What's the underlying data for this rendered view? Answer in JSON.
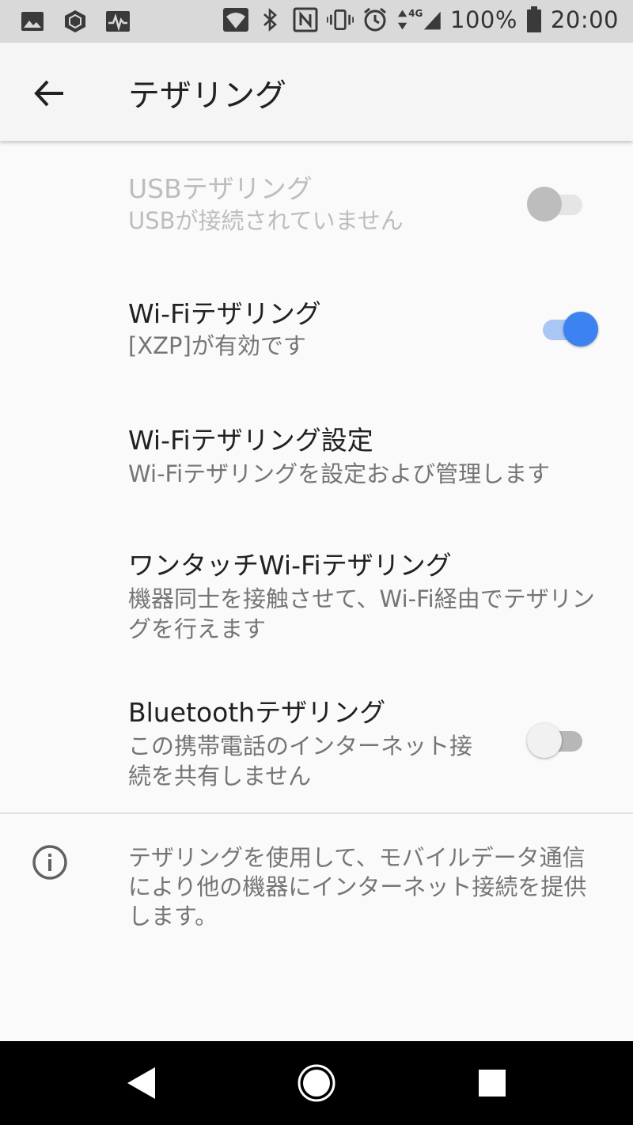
{
  "status_bar": {
    "left_icons": [
      "image-icon",
      "package-icon",
      "activity-icon"
    ],
    "right_icons": [
      "wifi-icon",
      "bluetooth-icon",
      "nfc-icon",
      "vibrate-icon",
      "alarm-icon",
      "signal-icon",
      "battery-icon"
    ],
    "network": "4G",
    "battery": "100%",
    "time": "20:00"
  },
  "app_bar": {
    "title": "テザリング"
  },
  "settings": [
    {
      "title": "USBテザリング",
      "subtitle": "USBが接続されていません",
      "toggle": "off",
      "enabled": false
    },
    {
      "title": "Wi-Fiテザリング",
      "subtitle": "[XZP]が有効です",
      "toggle": "on",
      "enabled": true
    },
    {
      "title": "Wi-Fiテザリング設定",
      "subtitle": "Wi-Fiテザリングを設定および管理します",
      "enabled": true
    },
    {
      "title": "ワンタッチWi-Fiテザリング",
      "subtitle": "機器同士を接触させて、Wi-Fi経由でテザリングを行えます",
      "enabled": true
    },
    {
      "title": "Bluetoothテザリング",
      "subtitle": "この携帯電話のインターネット接続を共有しません",
      "toggle": "off",
      "enabled": true
    }
  ],
  "info": {
    "text": "テザリングを使用して、モバイルデータ通信により他の機器にインターネット接続を提供します。"
  },
  "colors": {
    "accent": "#3d82f1",
    "status_bar": "#d9d9d9",
    "app_bar": "#f5f5f5",
    "background": "#fafafa"
  }
}
